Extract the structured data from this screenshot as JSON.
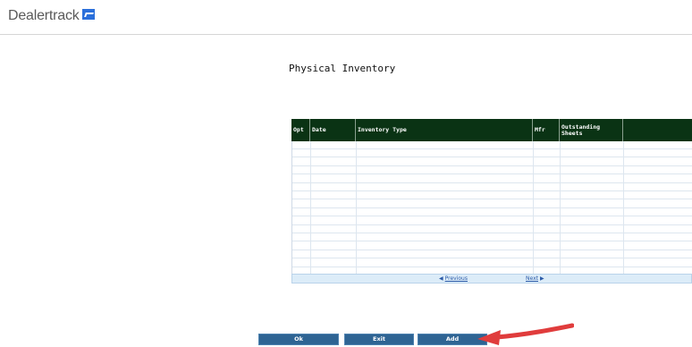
{
  "header": {
    "brand": "Dealertrack"
  },
  "page_title": "Physical Inventory",
  "table": {
    "columns": [
      "Opt",
      "Date",
      "Inventory Type",
      "Mfr",
      "Outstanding Sheets",
      ""
    ],
    "rows": [
      [
        "",
        "",
        "",
        "",
        "",
        ""
      ],
      [
        "",
        "",
        "",
        "",
        "",
        ""
      ],
      [
        "",
        "",
        "",
        "",
        "",
        ""
      ],
      [
        "",
        "",
        "",
        "",
        "",
        ""
      ],
      [
        "",
        "",
        "",
        "",
        "",
        ""
      ],
      [
        "",
        "",
        "",
        "",
        "",
        ""
      ],
      [
        "",
        "",
        "",
        "",
        "",
        ""
      ],
      [
        "",
        "",
        "",
        "",
        "",
        ""
      ],
      [
        "",
        "",
        "",
        "",
        "",
        ""
      ],
      [
        "",
        "",
        "",
        "",
        "",
        ""
      ],
      [
        "",
        "",
        "",
        "",
        "",
        ""
      ],
      [
        "",
        "",
        "",
        "",
        "",
        ""
      ],
      [
        "",
        "",
        "",
        "",
        "",
        ""
      ],
      [
        "",
        "",
        "",
        "",
        "",
        ""
      ],
      [
        "",
        "",
        "",
        "",
        "",
        ""
      ],
      [
        "",
        "",
        "",
        "",
        "",
        ""
      ]
    ]
  },
  "pager": {
    "previous_label": "Previous",
    "next_label": "Next"
  },
  "buttons": {
    "ok": "Ok",
    "exit": "Exit",
    "add": "Add"
  },
  "colors": {
    "header_bg": "#0a3314",
    "button_bg": "#2e6493",
    "arrow": "#e03c3c",
    "brand_blue": "#2a6fdb"
  }
}
